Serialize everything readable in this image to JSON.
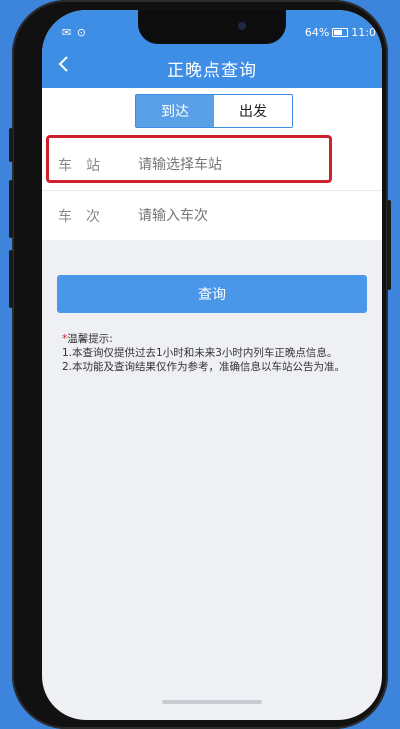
{
  "status": {
    "left_icons": "✉ ⊙",
    "battery": "64%",
    "time": "11:0"
  },
  "nav": {
    "title": "正晚点查询",
    "back_icon": "chevron-left-icon"
  },
  "segments": [
    {
      "label": "到达",
      "active": true
    },
    {
      "label": "出发",
      "active": false
    }
  ],
  "form": {
    "station_label": "车站",
    "station_placeholder": "请输选择车站",
    "train_label": "车次",
    "train_placeholder": "请输入车次"
  },
  "query_button": "查询",
  "tips": {
    "title": "温馨提示:",
    "line1": "1.本查询仅提供过去1小时和未来3小时内列车正晚点信息。",
    "line2": "2.本功能及查询结果仅作为参考，准确信息以车站公告为准。"
  },
  "colors": {
    "brand": "#3e8ee6",
    "highlight": "#d0202c"
  }
}
